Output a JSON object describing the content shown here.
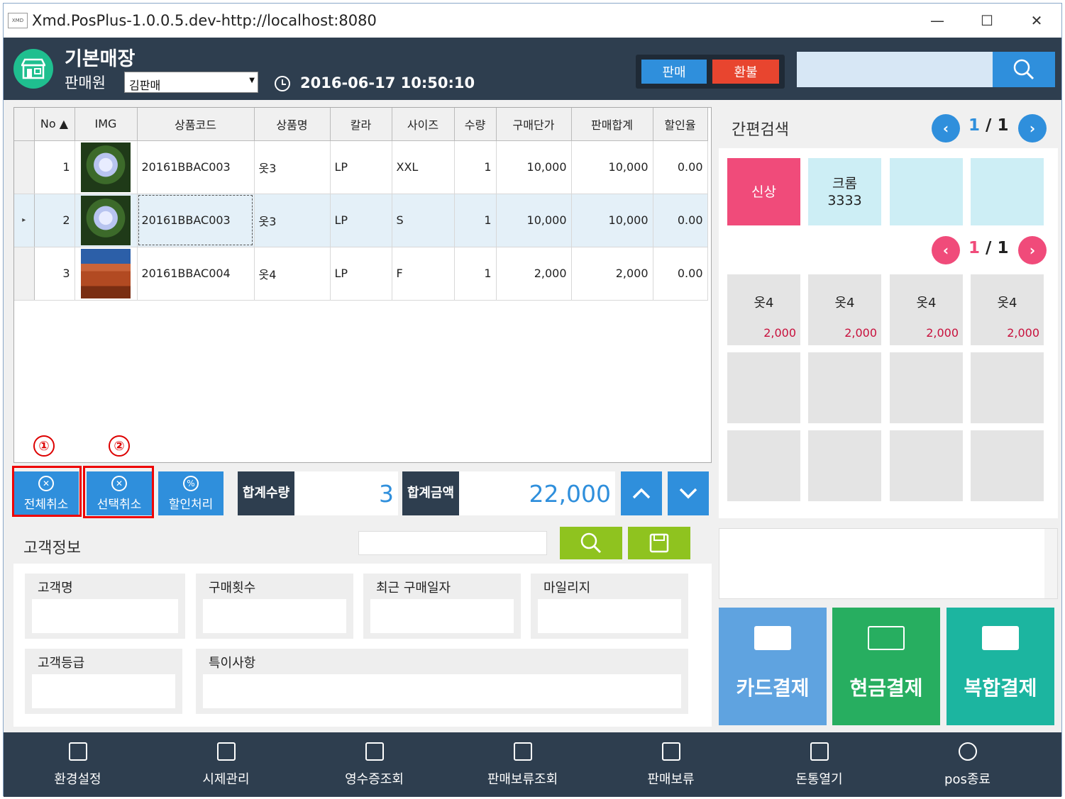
{
  "window": {
    "title": "Xmd.PosPlus-1.0.0.5.dev-http://localhost:8080",
    "logo_text": "XMD",
    "controls": [
      "—",
      "☐",
      "✕"
    ]
  },
  "header": {
    "store_name": "기본매장",
    "seller_label": "판매원",
    "seller_value": "김판매",
    "datetime": "2016-06-17 10:50:10",
    "sale_button": "판매",
    "refund_button": "환불",
    "search_placeholder": ""
  },
  "grid": {
    "columns": [
      "No ▲",
      "IMG",
      "상품코드",
      "상품명",
      "칼라",
      "사이즈",
      "수량",
      "구매단가",
      "판매합계",
      "할인율"
    ],
    "rows": [
      {
        "no": "1",
        "image": "flower",
        "code": "20161BBAC003",
        "name": "옷3",
        "color": "LP",
        "size": "XXL",
        "qty": "1",
        "unit_price": "10,000",
        "total": "10,000",
        "discount": "0.00"
      },
      {
        "no": "2",
        "image": "flower",
        "code": "20161BBAC003",
        "name": "옷3",
        "color": "LP",
        "size": "S",
        "qty": "1",
        "unit_price": "10,000",
        "total": "10,000",
        "discount": "0.00"
      },
      {
        "no": "3",
        "image": "desert",
        "code": "20161BBAC004",
        "name": "옷4",
        "color": "LP",
        "size": "F",
        "qty": "1",
        "unit_price": "2,000",
        "total": "2,000",
        "discount": "0.00"
      }
    ],
    "selected_row_marker": "▸"
  },
  "annotations": [
    "①",
    "②"
  ],
  "actions": {
    "cancel_all": "전체취소",
    "cancel_selected": "선택취소",
    "discount": "할인처리",
    "total_qty_label_1": "합계",
    "total_qty_label_2": "수량",
    "total_qty": "3",
    "total_amount_label_1": "합계",
    "total_amount_label_2": "금액",
    "total_amount": "22,000"
  },
  "customer": {
    "title": "고객정보",
    "fields": {
      "name": "고객명",
      "purchase_count": "구매횟수",
      "last_purchase": "최근 구매일자",
      "mileage": "마일리지",
      "grade": "고객등급",
      "notes": "특이사항"
    }
  },
  "quick_search": {
    "title": "간편검색",
    "category_page": "1",
    "category_total": "1",
    "categories": [
      "신상",
      "크롬\n3333",
      "",
      ""
    ],
    "product_page": "1",
    "product_total": "1",
    "products": [
      {
        "name": "옷4",
        "price": "2,000"
      },
      {
        "name": "옷4",
        "price": "2,000"
      },
      {
        "name": "옷4",
        "price": "2,000"
      },
      {
        "name": "옷4",
        "price": "2,000"
      }
    ]
  },
  "payment": {
    "card": "카드결제",
    "cash": "현금결제",
    "mixed": "복합결제"
  },
  "toolbar": {
    "items": [
      "환경설정",
      "시제관리",
      "영수증조회",
      "판매보류조회",
      "판매보류",
      "돈통열기",
      "pos종료"
    ]
  },
  "colors": {
    "header_bg": "#2e3e4f",
    "accent_blue": "#2f8fdc",
    "refund_red": "#e8452f",
    "new_pink": "#f04b7a",
    "green_btn": "#8fc31f",
    "card_pay": "#5fa3e0",
    "cash_pay": "#27ae60",
    "mixed_pay": "#1cb5a0"
  },
  "page_separator": "/"
}
